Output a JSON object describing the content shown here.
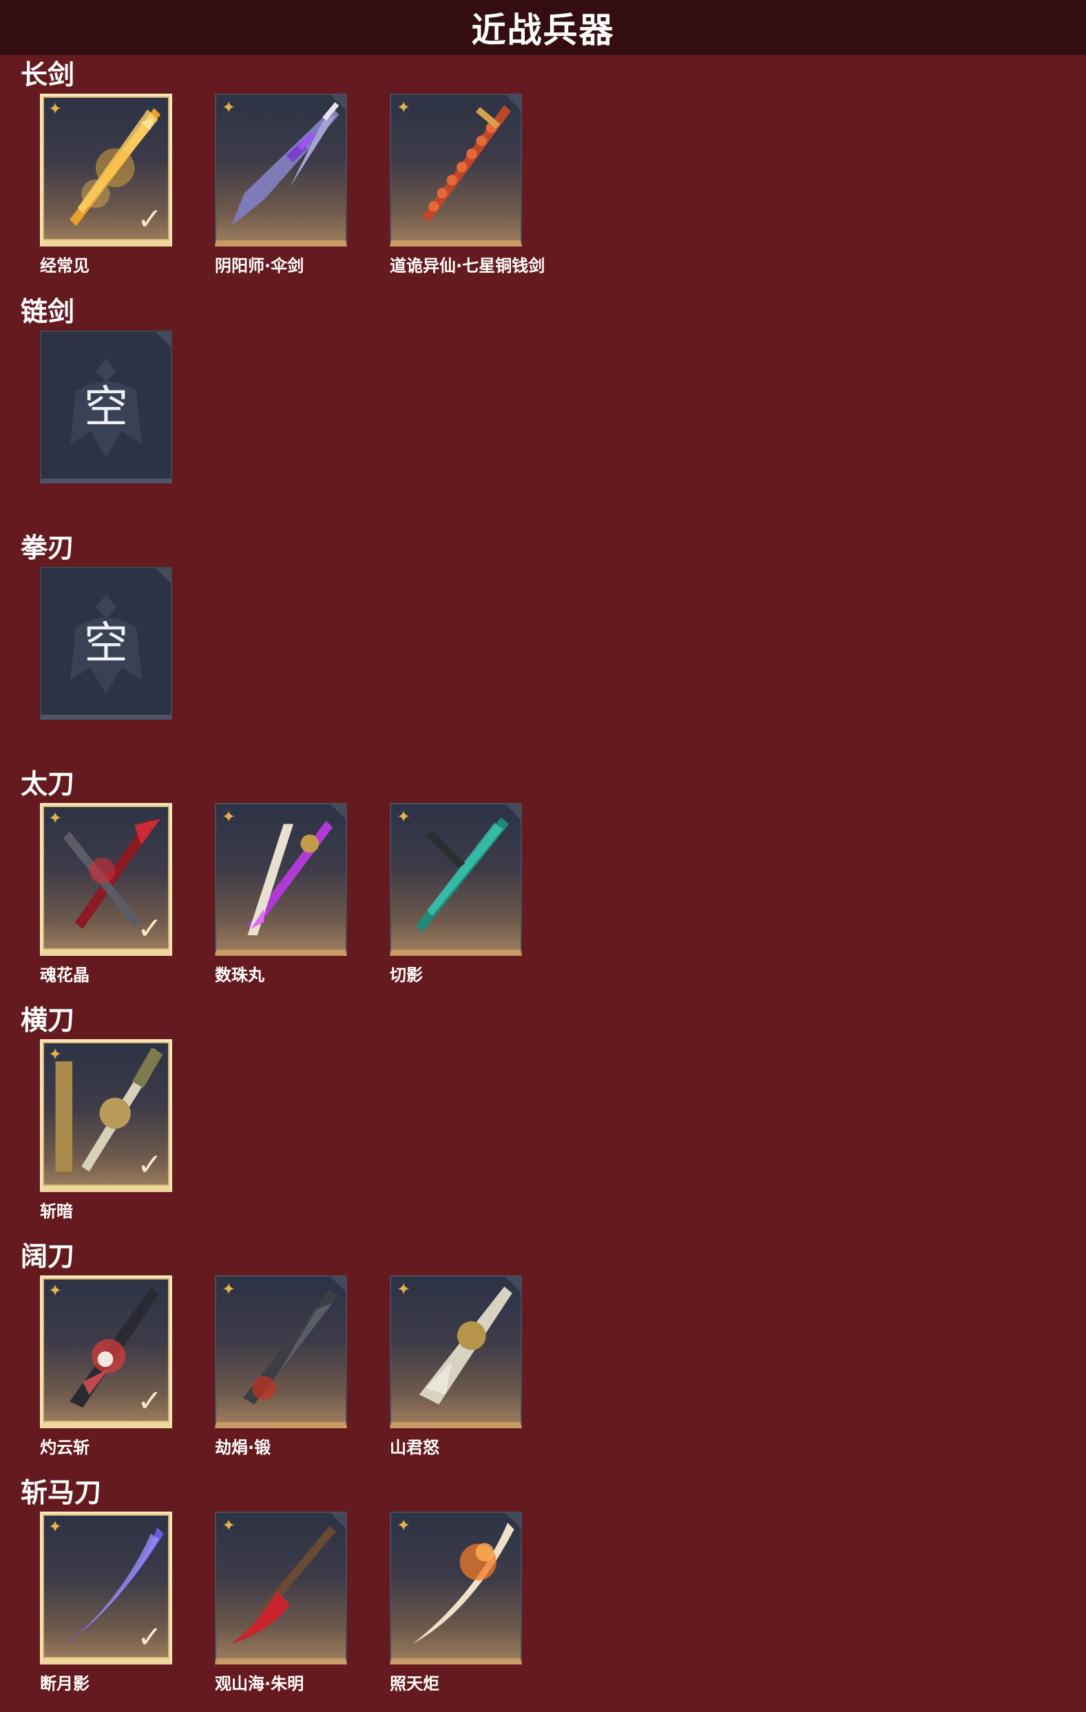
{
  "header": {
    "title": "近战兵器"
  },
  "colors": {
    "background": "#641a1e",
    "header": "#340d10",
    "accent": "#c89a66",
    "selected_border": "#f7e6b6"
  },
  "categories": [
    {
      "name": "长剑",
      "items": [
        {
          "name": "经常见",
          "selected": true,
          "icon": "golden-sword-icon"
        },
        {
          "name": "阴阳师·伞剑",
          "selected": false,
          "icon": "umbrella-sword-icon"
        },
        {
          "name": "道诡异仙·七星铜钱剑",
          "selected": false,
          "icon": "coin-sword-icon"
        }
      ]
    },
    {
      "name": "链剑",
      "empty_label": "空",
      "items": []
    },
    {
      "name": "拳刃",
      "empty_label": "空",
      "items": []
    },
    {
      "name": "太刀",
      "items": [
        {
          "name": "魂花晶",
          "selected": true,
          "icon": "crimson-katana-icon"
        },
        {
          "name": "数珠丸",
          "selected": false,
          "icon": "purple-katana-icon"
        },
        {
          "name": "切影",
          "selected": false,
          "icon": "jade-katana-icon"
        }
      ]
    },
    {
      "name": "横刀",
      "items": [
        {
          "name": "斩暗",
          "selected": true,
          "icon": "golden-dao-icon"
        }
      ]
    },
    {
      "name": "阔刀",
      "items": [
        {
          "name": "灼云斩",
          "selected": true,
          "icon": "flame-broadsword-icon"
        },
        {
          "name": "劫焆·锻",
          "selected": false,
          "icon": "dark-broadsword-icon"
        },
        {
          "name": "山君怒",
          "selected": false,
          "icon": "tiger-broadsword-icon"
        }
      ]
    },
    {
      "name": "斩马刀",
      "items": [
        {
          "name": "断月影",
          "selected": true,
          "icon": "violet-glaive-icon"
        },
        {
          "name": "观山海·朱明",
          "selected": false,
          "icon": "red-glaive-icon"
        },
        {
          "name": "照天炬",
          "selected": false,
          "icon": "fire-glaive-icon"
        }
      ]
    }
  ]
}
